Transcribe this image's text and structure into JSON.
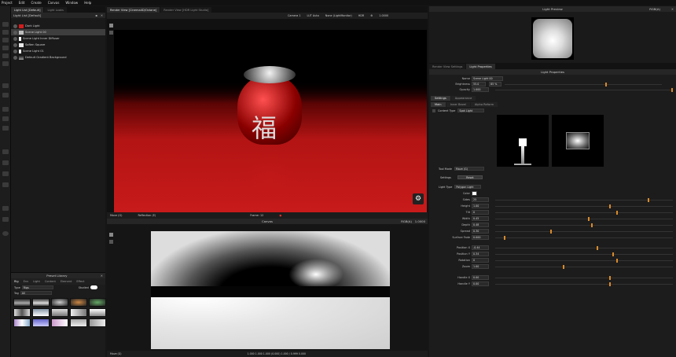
{
  "menu": [
    "Project",
    "Edit",
    "Create",
    "Canvas",
    "Window",
    "Help"
  ],
  "light_list": {
    "tabs": [
      "Light List [Default]",
      "Light Looks"
    ],
    "title": "Light List [Default]",
    "items": [
      {
        "name": "Dark Light",
        "color": "#d11c1c"
      },
      {
        "name": "Scene Light 00",
        "color": "#bdbdbd"
      },
      {
        "name": "Scene Light Inner Diffuser",
        "color": "#ffffff"
      },
      {
        "name": "Soften Square",
        "color": "#e8e8e8"
      },
      {
        "name": "Scene Light 01",
        "color": "#ffffff"
      },
      {
        "name": "Default Gradient Background",
        "color": "#7a7a7a"
      }
    ]
  },
  "preset_library": {
    "title": "Preset Library",
    "tabs": [
      "Rig",
      "Env",
      "Light",
      "Content",
      "Element",
      "Effect"
    ],
    "type_label": "Type",
    "type_value": "Rigs",
    "tag_label": "Tag",
    "tag_value": "All",
    "toggle_label": "Studied"
  },
  "render_view": {
    "tabs": [
      "Render View [Cinema4D/Octane]",
      "Render View [HDR Light Studio]"
    ],
    "camera": "Camera 1",
    "lut": "LUT Auto",
    "overlay": "None (LightMonitor)",
    "hdr": "HDR",
    "value": "1.0000",
    "footer_left": "Move (G)",
    "footer_mid": "Reflection (E)",
    "frame": "Frame: 12",
    "glyph": "福"
  },
  "canvas": {
    "title": "Canvas",
    "mode": "RGB(A)",
    "value": "1.0000",
    "footer_left": "Move (G)",
    "readout": "1.000 1.000 1.000 (0.000) 1.000 / 0.999 0.000"
  },
  "light_preview": {
    "title": "Light Preview",
    "mode": "RGB(A)"
  },
  "properties": {
    "tabs": [
      "Render View Settings",
      "Light Properties"
    ],
    "title": "Light Properties",
    "name_label": "Name",
    "name_value": "Scene Light 00",
    "brightness_label": "Brightness",
    "brightness_value": "55.0",
    "brightness_unit": "85 %",
    "opacity_label": "Opacity",
    "opacity_value": "1.000",
    "section_tabs": [
      "Settings",
      "Appearance"
    ],
    "sub_tabs": [
      "Main",
      "Inner Bezel",
      "Alpha Reform"
    ],
    "content_type_label": "Content Type",
    "content_type_value": "Spot Light",
    "tool_mode_label": "Tool Mode",
    "tool_mode_value": "Move (G)",
    "settings_label": "Settings",
    "reset_label": "Reset",
    "light_type_label": "Light Type",
    "light_type_value": "Polygon Light",
    "color_label": "Color",
    "params": [
      {
        "label": "Sides",
        "value": "25",
        "knob": 0.86
      },
      {
        "label": "Height",
        "value": "1.00",
        "knob": 0.64
      },
      {
        "label": "Tilt",
        "value": "0",
        "knob": 0.68
      },
      {
        "label": "Width",
        "value": "0.45",
        "knob": 0.52
      },
      {
        "label": "Depth",
        "value": "0.48",
        "knob": 0.54
      },
      {
        "label": "Spread",
        "value": "0.30",
        "knob": 0.31
      },
      {
        "label": "Surface Fade",
        "value": "0.000",
        "knob": 0.05
      },
      {
        "label": "Position X",
        "value": "-0.44",
        "knob": 0.57
      },
      {
        "label": "Position Y",
        "value": "0.34",
        "knob": 0.66
      },
      {
        "label": "Rotation",
        "value": "0",
        "knob": 0.68
      },
      {
        "label": "Zoom",
        "value": "1.00",
        "knob": 0.38
      },
      {
        "label": "Handle X",
        "value": "0.00",
        "knob": 0.64
      },
      {
        "label": "Handle Y",
        "value": "0.00",
        "knob": 0.64
      }
    ]
  }
}
